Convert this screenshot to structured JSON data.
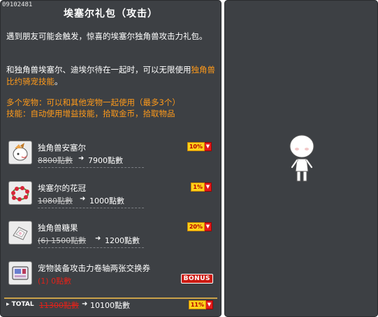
{
  "package": {
    "code": "09102481",
    "title": "埃塞尔礼包（攻击）",
    "desc1": "遇到朋友可能会触发，惊喜的埃塞尔独角兽攻击力礼包。",
    "desc2_main": "和独角兽埃塞尔、迪埃尔待在一起时，可以无限使用",
    "desc2_highlight": "独角兽比约骑宠技能",
    "desc2_end": "。",
    "multi_pet": "多个宠物：可以和其他宠物一起使用（最多3个）",
    "skills": "技能：自动使用增益技能，拾取金币，拾取物品"
  },
  "items": [
    {
      "name": "独角兽安塞尔",
      "old_price": "8800點數",
      "new_price": "7900點數",
      "discount": "10%",
      "icon": "unicorn-pet-icon"
    },
    {
      "name": "埃塞尔的花冠",
      "old_price": "1080點數",
      "new_price": "1000點數",
      "discount": "1%",
      "icon": "flower-crown-icon"
    },
    {
      "name": "独角兽糖果",
      "old_price": "(6) 1500點數",
      "new_price": "1200點數",
      "discount": "20%",
      "icon": "candy-icon"
    },
    {
      "name": "宠物装备攻击力卷轴两张交换券",
      "old_price": "(1) 0點數",
      "bonus": "BONUS",
      "icon": "scroll-coupon-icon"
    }
  ],
  "total": {
    "label": "TOTAL",
    "old_price": "11300點數",
    "new_price": "10100點數",
    "discount": "11%"
  },
  "colors": {
    "panel": "#3d4044",
    "highlight": "#ff9a1a",
    "badge_yellow": "#ffd21a",
    "badge_red": "#e31c1c"
  }
}
